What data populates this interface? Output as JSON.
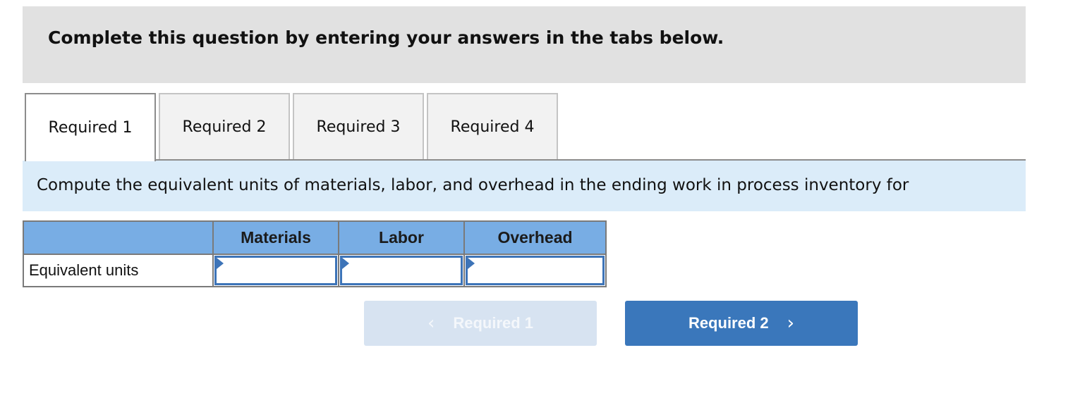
{
  "instruction": "Complete this question by entering your answers in the tabs below.",
  "tabs": [
    {
      "label": "Required 1",
      "active": true
    },
    {
      "label": "Required 2",
      "active": false
    },
    {
      "label": "Required 3",
      "active": false
    },
    {
      "label": "Required 4",
      "active": false
    }
  ],
  "prompt": "Compute the equivalent units of materials, labor, and overhead in the ending work in process inventory for",
  "table": {
    "headers": [
      "",
      "Materials",
      "Labor",
      "Overhead"
    ],
    "rows": [
      {
        "label": "Equivalent units",
        "values": {
          "materials": "",
          "labor": "",
          "overhead": ""
        }
      }
    ]
  },
  "navigation": {
    "prev": {
      "label": "Required 1",
      "icon": "chevron-left-icon",
      "glyph": "‹",
      "disabled": true
    },
    "next": {
      "label": "Required 2",
      "icon": "chevron-right-icon",
      "glyph": "›",
      "disabled": false
    }
  },
  "colors": {
    "header_bg": "#78ade4",
    "prompt_bg": "#dbecf9",
    "input_border": "#3d74b8",
    "next_button": "#3a77bb",
    "prev_button_disabled": "#d7e3f1"
  }
}
